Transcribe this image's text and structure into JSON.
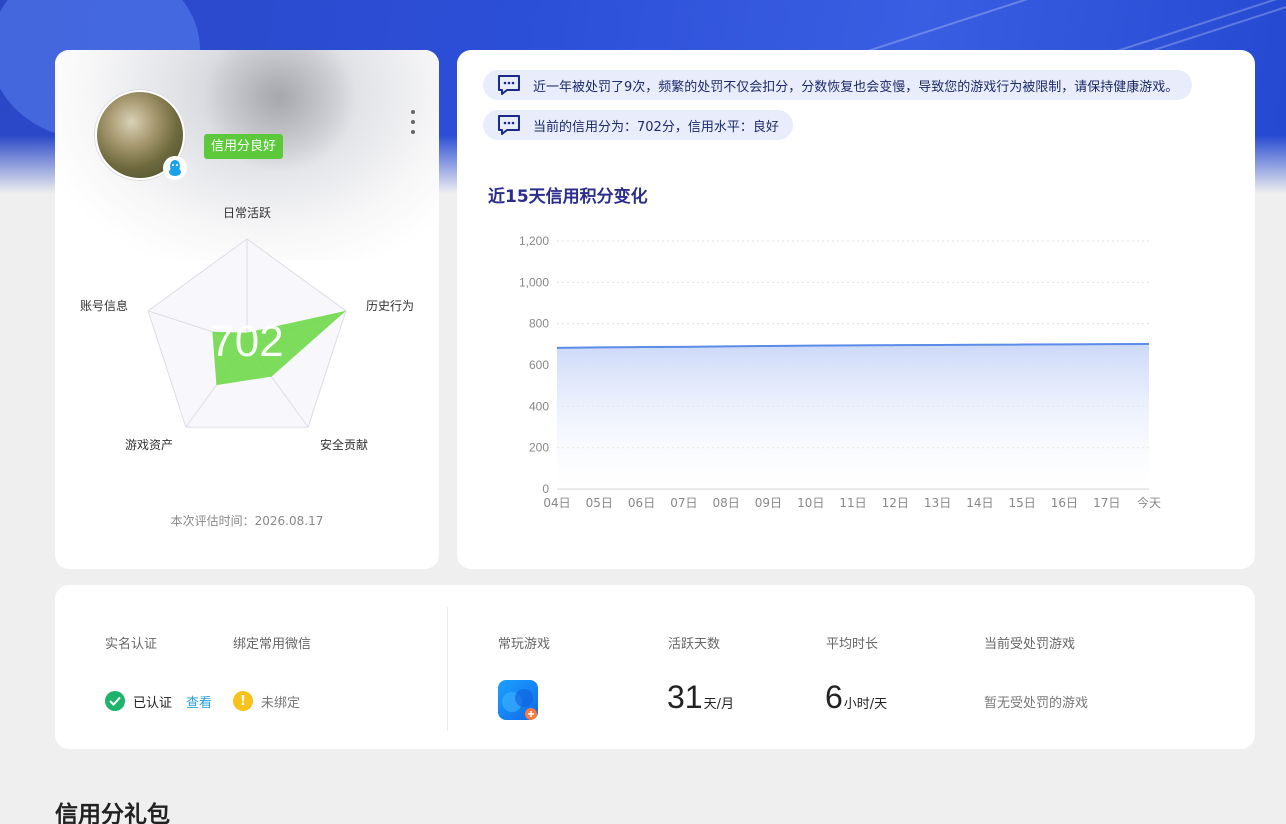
{
  "profile": {
    "score_badge": "信用分良好",
    "radar": {
      "score": "702",
      "axes": [
        "日常活跃",
        "历史行为",
        "安全贡献",
        "游戏资产",
        "账号信息"
      ],
      "values": [
        0.1,
        1.0,
        0.4,
        0.5,
        0.35
      ]
    },
    "eval_time": "本次评估时间：2026.08.17"
  },
  "notices": [
    "近一年被处罚了9次，频繁的处罚不仅会扣分，分数恢复也会变慢，导致您的游戏行为被限制，请保持健康游戏。",
    "当前的信用分为：702分，信用水平：良好"
  ],
  "chart_title": "近15天信用积分变化",
  "chart_data": {
    "type": "area",
    "title": "近15天信用积分变化",
    "categories": [
      "04日",
      "05日",
      "06日",
      "07日",
      "08日",
      "09日",
      "10日",
      "11日",
      "12日",
      "13日",
      "14日",
      "15日",
      "16日",
      "17日",
      "今天"
    ],
    "values": [
      683,
      685,
      687,
      688,
      690,
      692,
      694,
      695,
      696,
      697,
      698,
      699,
      700,
      701,
      702
    ],
    "y_ticks": [
      "0",
      "200",
      "400",
      "600",
      "800",
      "1,000",
      "1,200"
    ],
    "ylim": [
      0,
      1200
    ],
    "grid": true,
    "color": "#5b8ce8"
  },
  "info": {
    "realname_label": "实名认证",
    "wechat_label": "绑定常用微信",
    "realname_status": "已认证",
    "view_link": "查看",
    "wechat_status": "未绑定",
    "game_label": "常玩游戏",
    "active_days_label": "活跃天数",
    "active_days_value": "31",
    "active_days_unit": "天/月",
    "avg_time_label": "平均时长",
    "avg_time_value": "6",
    "avg_time_unit": "小时/天",
    "punish_label": "当前受处罚游戏",
    "punish_value": "暂无受处罚的游戏"
  },
  "section_title": "信用分礼包"
}
